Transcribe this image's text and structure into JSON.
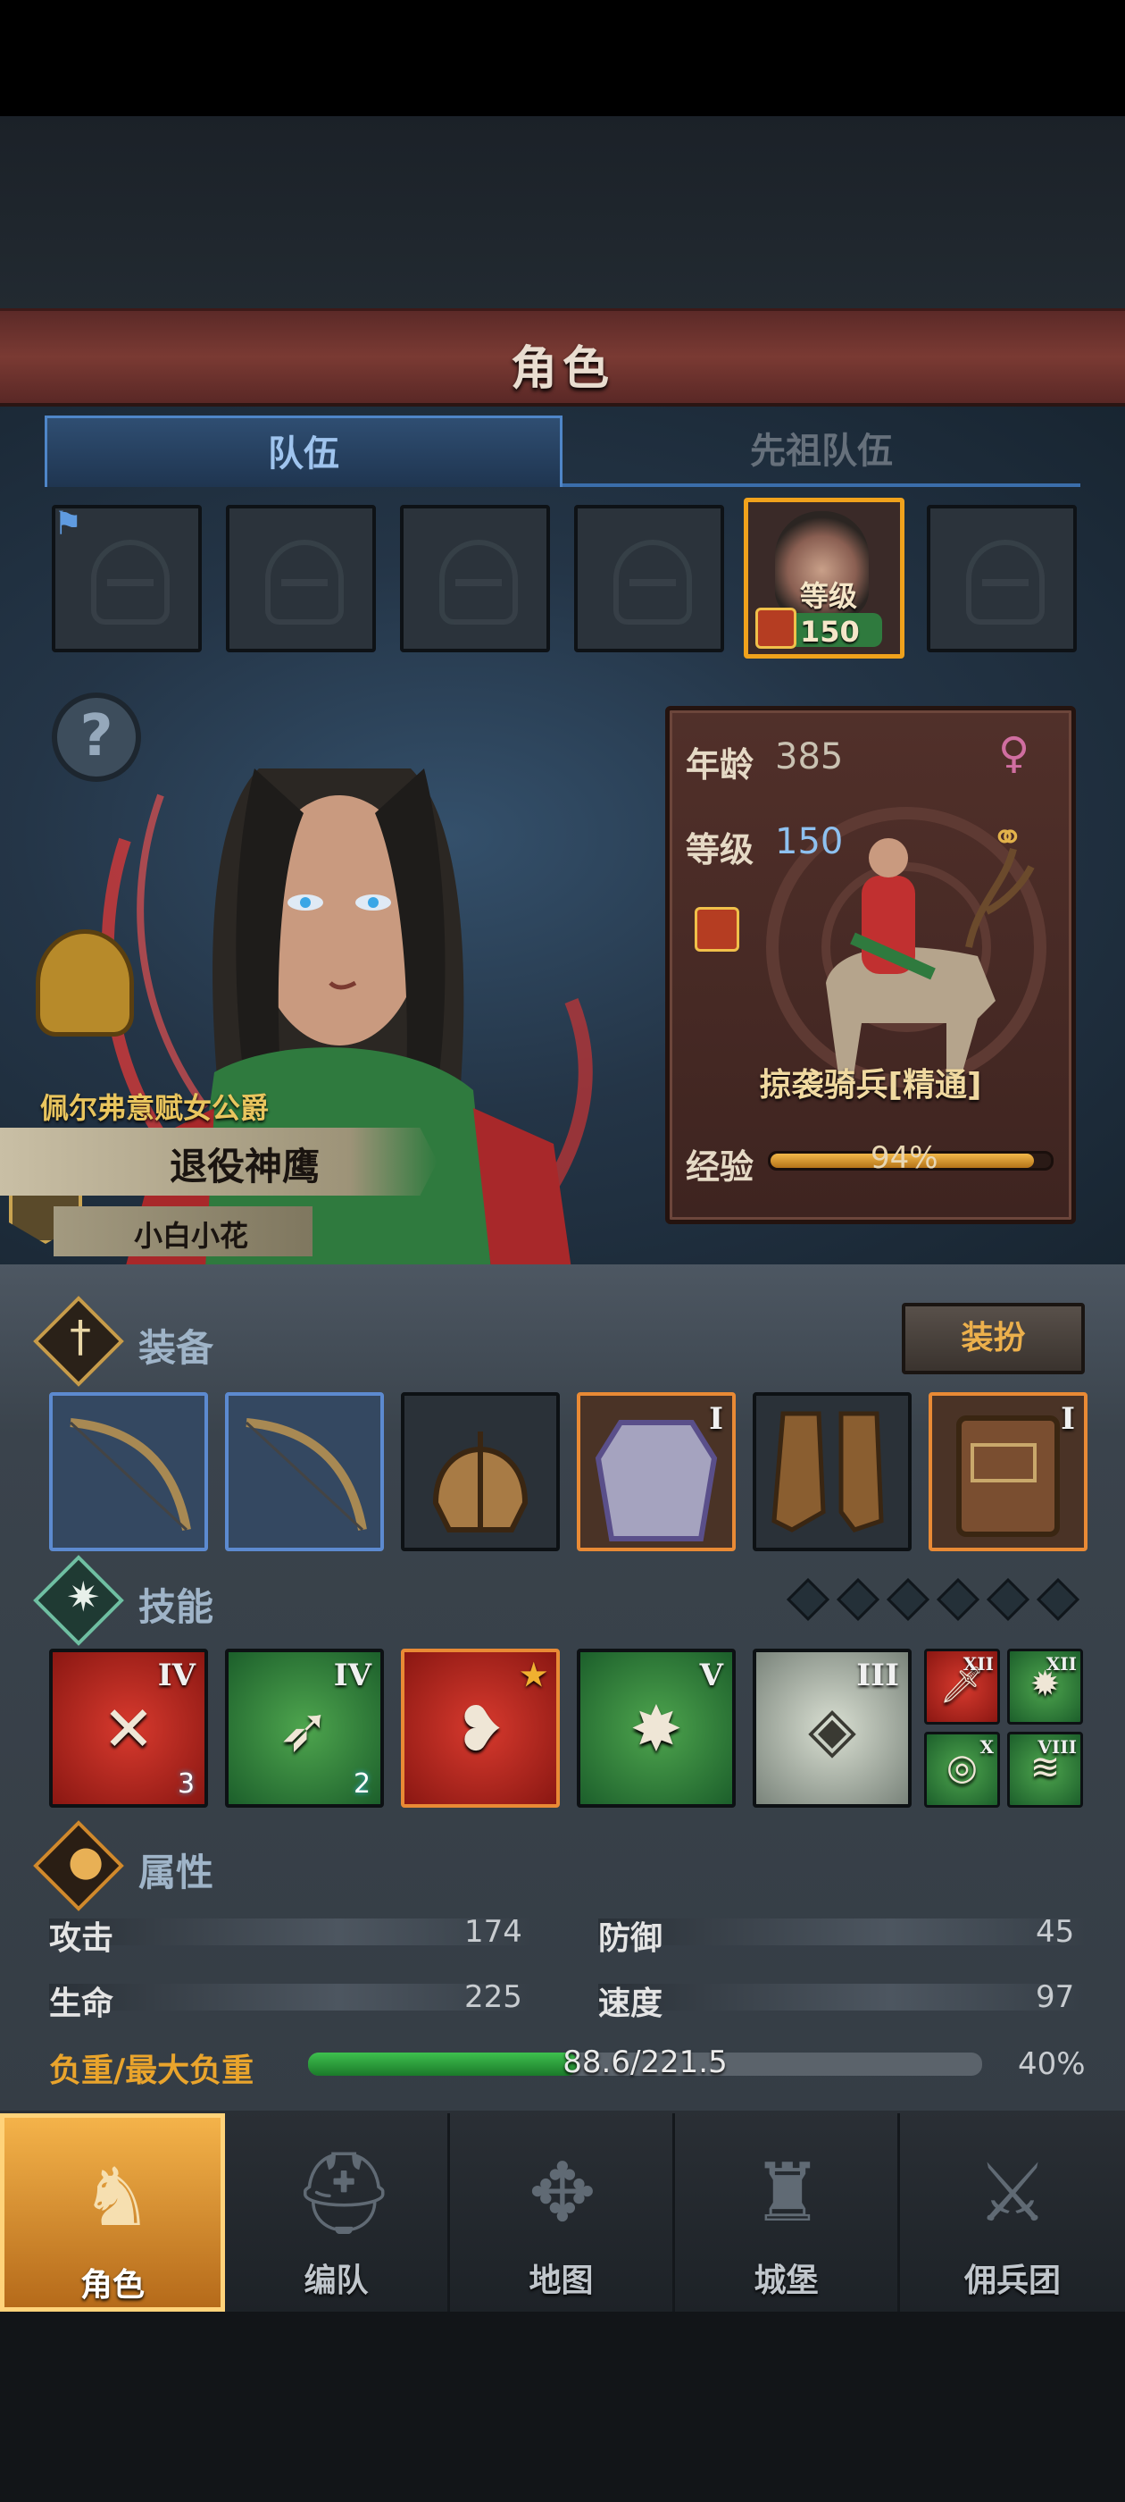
{
  "header": {
    "title": "角色"
  },
  "tabs": [
    {
      "label": "队伍",
      "active": true
    },
    {
      "label": "先祖队伍",
      "active": false
    }
  ],
  "team_slots": {
    "active_slot_level": "等级150"
  },
  "character": {
    "noble_title": "佩尔弗意赋女公爵",
    "name": "退役神鹰",
    "player": "小白小花",
    "age_label": "年龄",
    "age": "385",
    "level_label": "等级",
    "level": "150",
    "unit_class": "掠袭骑兵[精通]",
    "exp_label": "经验",
    "exp_percent": "94%",
    "exp_fraction": 0.94
  },
  "equipment": {
    "label": "装备",
    "dress_button": "装扮",
    "slots": [
      {
        "icon": "bow-icon",
        "tier": ""
      },
      {
        "icon": "bow-icon",
        "tier": ""
      },
      {
        "icon": "helmet-icon",
        "tier": ""
      },
      {
        "icon": "armor-icon",
        "tier": "I"
      },
      {
        "icon": "boots-icon",
        "tier": ""
      },
      {
        "icon": "book-icon",
        "tier": "I"
      }
    ]
  },
  "skills": {
    "label": "技能",
    "items": [
      {
        "tier": "IV",
        "badge": "3",
        "glyph": "✕"
      },
      {
        "tier": "IV",
        "badge": "2",
        "glyph": "➶"
      },
      {
        "tier": "★",
        "badge": "",
        "glyph": "❥"
      },
      {
        "tier": "V",
        "badge": "",
        "glyph": "✸"
      },
      {
        "tier": "III",
        "badge": "",
        "glyph": "◈"
      }
    ],
    "mini": [
      {
        "tier": "XII",
        "glyph": "🗡"
      },
      {
        "tier": "XII",
        "glyph": "✹"
      },
      {
        "tier": "X",
        "glyph": "◎"
      },
      {
        "tier": "VIII",
        "glyph": "≋"
      }
    ]
  },
  "attributes": {
    "label": "属性",
    "attack_label": "攻击",
    "attack": "174",
    "defense_label": "防御",
    "defense": "45",
    "hp_label": "生命",
    "hp": "225",
    "speed_label": "速度",
    "speed": "97",
    "load_label": "负重/最大负重",
    "load_value": "88.6/221.5",
    "load_percent": "40%",
    "load_fraction": 0.4
  },
  "nav": [
    {
      "label": "角色",
      "icon": "knight-icon"
    },
    {
      "label": "编队",
      "icon": "helmet-icon"
    },
    {
      "label": "地图",
      "icon": "compass-icon"
    },
    {
      "label": "城堡",
      "icon": "castle-icon"
    },
    {
      "label": "佣兵团",
      "icon": "mercenary-icon"
    }
  ],
  "colors": {
    "accent": "#f0a21c",
    "panel": "#4a2a25",
    "tab_blue": "#4f86c8"
  }
}
